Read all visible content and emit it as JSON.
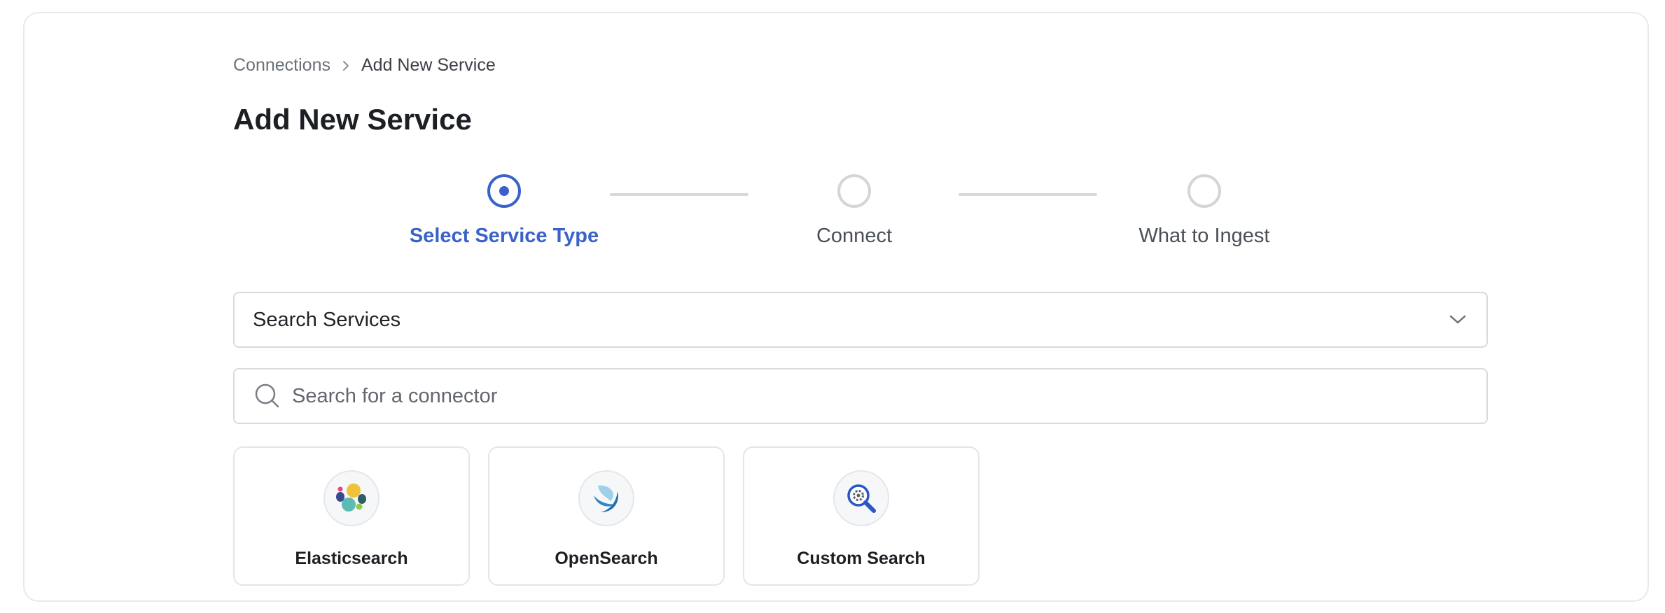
{
  "breadcrumb": {
    "parent": "Connections",
    "current": "Add New Service"
  },
  "page_title": "Add New Service",
  "stepper": {
    "steps": [
      {
        "label": "Select Service Type",
        "state": "active"
      },
      {
        "label": "Connect",
        "state": "pending"
      },
      {
        "label": "What to Ingest",
        "state": "pending"
      }
    ]
  },
  "service_category_select": {
    "value": "Search Services",
    "icon": "chevron-down-icon"
  },
  "connector_search": {
    "placeholder": "Search for a connector",
    "icon": "search-icon"
  },
  "connectors": [
    {
      "label": "Elasticsearch",
      "icon": "elasticsearch-logo-icon"
    },
    {
      "label": "OpenSearch",
      "icon": "opensearch-logo-icon"
    },
    {
      "label": "Custom Search",
      "icon": "custom-search-icon"
    }
  ],
  "colors": {
    "accent": "#3a63c9",
    "border": "#d8dade",
    "muted_text": "#6b7079"
  }
}
